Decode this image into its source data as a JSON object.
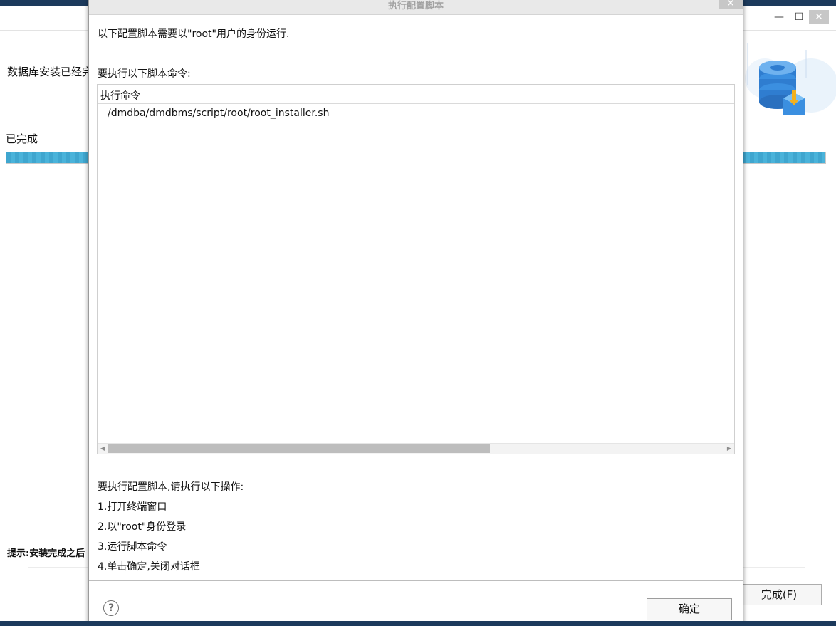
{
  "background_window": {
    "title_buttons": {
      "minimize": "—",
      "maximize": "☐",
      "close": "✕"
    },
    "install_complete_text": "数据库安装已经完",
    "completed_label": "已完成",
    "progress_fraction": 1.0,
    "hint_text": "提示:安装完成之后",
    "finish_button": "完成(F)"
  },
  "dialog": {
    "title": "执行配置脚本",
    "close_glyph": "✕",
    "intro": "以下配置脚本需要以\"root\"用户的身份运行.",
    "commands_label": "要执行以下脚本命令:",
    "table": {
      "header": "执行命令",
      "rows": [
        "/dmdba/dmdbms/script/root/root_installer.sh"
      ]
    },
    "instructions_title": "要执行配置脚本,请执行以下操作:",
    "steps": [
      "1.打开终端窗口",
      "2.以\"root\"身份登录",
      "3.运行脚本命令",
      "4.单击确定,关闭对话框"
    ],
    "help_glyph": "?",
    "ok_button": "确定"
  },
  "colors": {
    "progress": "#3fa6cf",
    "dialog_title_text": "#a2a2a2",
    "accent_logo": "#2f86d6"
  }
}
